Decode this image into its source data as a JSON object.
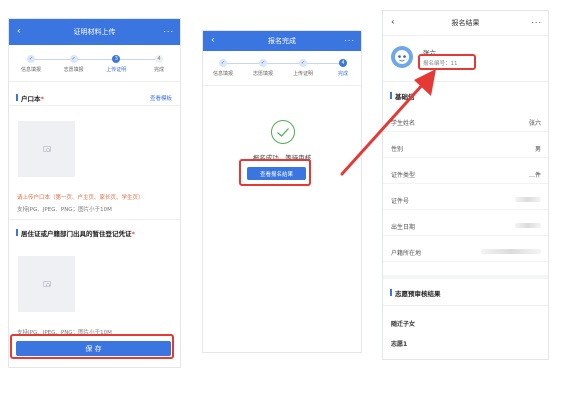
{
  "phone1": {
    "title": "证明材料上传",
    "back_icon": "‹",
    "more_icon": "···",
    "steps": [
      {
        "num": "✓",
        "label": "信息填报",
        "state": "done"
      },
      {
        "num": "✓",
        "label": "志愿填报",
        "state": "done"
      },
      {
        "num": "3",
        "label": "上传证明",
        "state": "active"
      },
      {
        "num": "4",
        "label": "完成",
        "state": "todo"
      }
    ],
    "section1_title": "户口本",
    "section1_required": "*",
    "view_sample": "查看模板",
    "upload_hint": "请上传户口本（第一页、户主页、家长页、学生页）",
    "format_hint": "支持JPG、JPEG、PNG；图片小于10M",
    "section2_title": "居住证或户籍部门出具的暂住登记凭证",
    "section2_required": "*",
    "format_hint2": "支持JPG、JPEG、PNG；图片小于10M",
    "save_button": "保 存"
  },
  "phone2": {
    "title": "报名完成",
    "back_icon": "‹",
    "more_icon": "···",
    "steps": [
      {
        "num": "✓",
        "label": "信息填报",
        "state": "done"
      },
      {
        "num": "✓",
        "label": "志愿填报",
        "state": "done"
      },
      {
        "num": "✓",
        "label": "上传证明",
        "state": "done"
      },
      {
        "num": "4",
        "label": "完成",
        "state": "active"
      }
    ],
    "success_text": "报名成功，等待审核",
    "view_result_button": "查看报名结果"
  },
  "phone3": {
    "title": "报名结果",
    "back_icon": "‹",
    "more_icon": "···",
    "name": "张六",
    "reg_number": "报名编号：11",
    "section_basic": "基础信",
    "rows": [
      {
        "label": "学生姓名",
        "value": "张六"
      },
      {
        "label": "性别",
        "value": "男"
      },
      {
        "label": "证件类型",
        "value": "…件"
      },
      {
        "label": "证件号",
        "value": ""
      },
      {
        "label": "出生日期",
        "value": ""
      },
      {
        "label": "户籍所在地",
        "value": ""
      }
    ],
    "section_review": "志愿预审核结果",
    "category": "随迁子女",
    "choice": "志愿1"
  },
  "colors": {
    "accent": "#3b75e0",
    "highlight": "#e53935"
  }
}
